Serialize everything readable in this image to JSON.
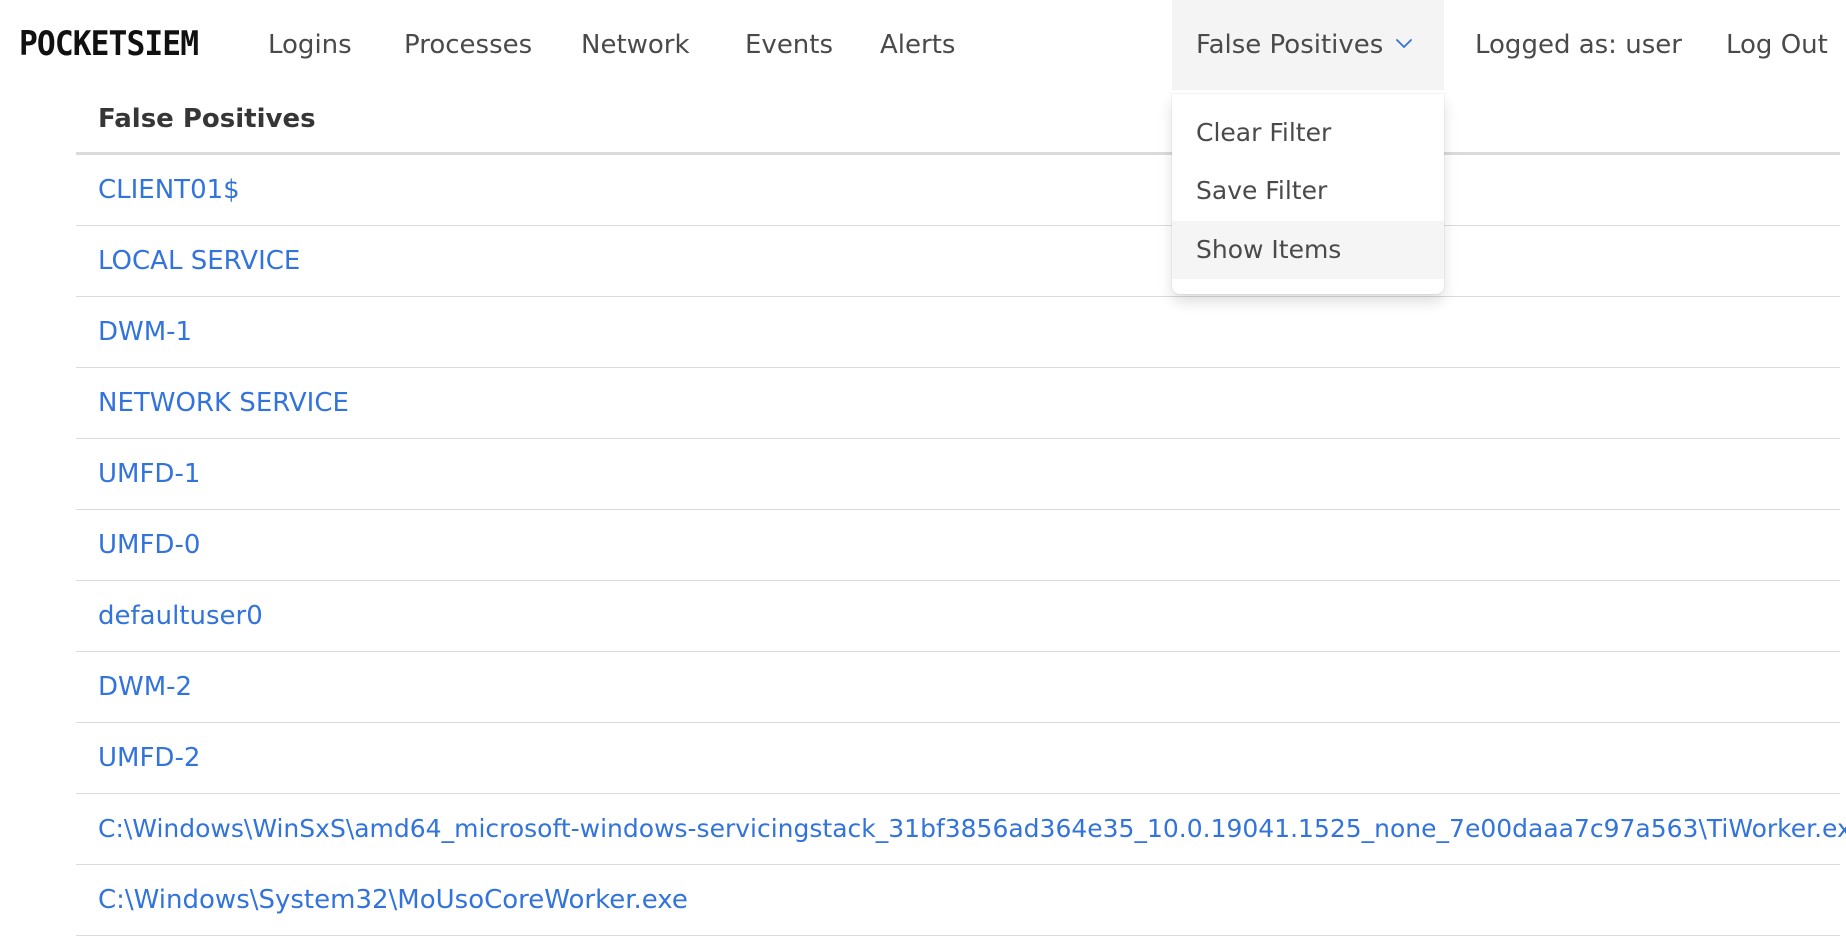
{
  "brand": "POCKETSIEM",
  "nav": {
    "logins": "Logins",
    "processes": "Processes",
    "network": "Network",
    "events": "Events",
    "alerts": "Alerts",
    "false_positives": "False Positives",
    "logged_as": "Logged as: user",
    "logout": "Log Out"
  },
  "dropdown": {
    "items": [
      "Clear Filter",
      "Save Filter",
      "Show Items"
    ],
    "active_item": "Show Items"
  },
  "table": {
    "header": "False Positives",
    "rows": [
      "CLIENT01$",
      "LOCAL SERVICE",
      "DWM-1",
      "NETWORK SERVICE",
      "UMFD-1",
      "UMFD-0",
      "defaultuser0",
      "DWM-2",
      "UMFD-2",
      "C:\\Windows\\WinSxS\\amd64_microsoft-windows-servicingstack_31bf3856ad364e35_10.0.19041.1525_none_7e00daaa7c97a563\\TiWorker.exe",
      "C:\\Windows\\System32\\MoUsoCoreWorker.exe"
    ]
  },
  "colors": {
    "link": "#3273dc",
    "nav_text": "#4a4a4a",
    "active_bg": "#f4f4f4",
    "divider": "#dbdbdb"
  },
  "icons": {
    "dropdown_chevron": "chevron-down-icon"
  }
}
